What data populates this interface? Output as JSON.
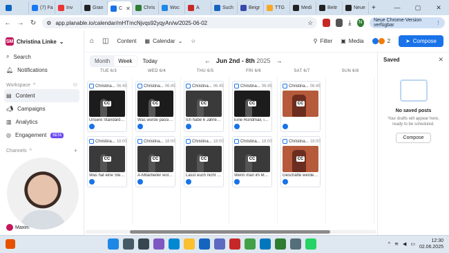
{
  "browser": {
    "tabs": [
      {
        "label": "",
        "color": "#0a66c2"
      },
      {
        "label": "(7) Fa",
        "color": "#1877f2"
      },
      {
        "label": "Inv",
        "color": "#e33"
      },
      {
        "label": "Gran",
        "color": "#222"
      },
      {
        "label": "C",
        "color": "#1a73e8",
        "active": true
      },
      {
        "label": "Chris",
        "color": "#2e7d32"
      },
      {
        "label": "Woc",
        "color": "#1e88e5"
      },
      {
        "label": "A",
        "color": "#c62828"
      },
      {
        "label": "Such",
        "color": "#1565c0"
      },
      {
        "label": "Beigr",
        "color": "#3949ab"
      },
      {
        "label": "TTG",
        "color": "#f9a825"
      },
      {
        "label": "Medi",
        "color": "#222"
      },
      {
        "label": "Beitr",
        "color": "#222"
      },
      {
        "label": "Neue",
        "color": "#222"
      }
    ],
    "url": "app.planable.io/calendar/mHTmcNjvqs92yqyAn/w/2025-06-02",
    "update_label": "Neue Chrome-Version verfügbar",
    "profile_initial": "N"
  },
  "sidebar": {
    "workspace_name": "Christina Linke",
    "logo_text": "SM",
    "items": [
      {
        "label": "Search",
        "icon": "search-icon"
      },
      {
        "label": "Notifications",
        "icon": "bell-icon"
      }
    ],
    "workspace_section": "Workspace",
    "workspace_items": [
      {
        "label": "Content",
        "icon": "content-icon",
        "active": true
      },
      {
        "label": "Campaigns",
        "icon": "megaphone-icon"
      },
      {
        "label": "Analytics",
        "icon": "analytics-icon"
      },
      {
        "label": "Engagement",
        "icon": "engagement-icon",
        "badge": "BETA"
      }
    ],
    "channels_section": "Channels",
    "user_label": "Maxim"
  },
  "topbar": {
    "content_label": "Content",
    "calendar_label": "Calendar",
    "filter_label": "Filter",
    "media_label": "Media",
    "avatars_count": "2",
    "compose_label": "Compose"
  },
  "calendar": {
    "view_month": "Month",
    "view_week": "Week",
    "today_label": "Today",
    "range": "Jun 2nd - 8th",
    "year": "2025",
    "days": [
      "TUE 6/3",
      "WED 6/4",
      "THU 6/5",
      "FRI 6/6",
      "SAT 6/7",
      "SUN 6/8"
    ],
    "columns": [
      {
        "posts": [
          {
            "author": "Christina...",
            "time": "06:45",
            "caption": "Unsere Standards g...",
            "style": "dark"
          },
          {
            "author": "Christina...",
            "time": "18:00",
            "caption": "Was hat eine Steuer...",
            "style": "stage"
          }
        ]
      },
      {
        "posts": [
          {
            "author": "Christina...",
            "time": "06:45",
            "caption": "Was würde passiere...",
            "style": "dark"
          },
          {
            "author": "Christina...",
            "time": "18:00",
            "caption": "A-Mitarbeiter wolle...",
            "style": "stage"
          }
        ]
      },
      {
        "posts": [
          {
            "author": "Christina...",
            "time": "06:45",
            "caption": "Ich habe 6 Jahre lan...",
            "style": "stage"
          },
          {
            "author": "Christina...",
            "time": "18:00",
            "caption": "Lasst euch nicht vo...",
            "style": "stage"
          }
        ]
      },
      {
        "posts": [
          {
            "author": "Christina...",
            "time": "06:45",
            "caption": "Eine Rundmail, in d...",
            "style": "dark"
          },
          {
            "author": "Christina...",
            "time": "18:00",
            "caption": "Wenn man im Mom...",
            "style": "stage"
          }
        ]
      },
      {
        "posts": [
          {
            "author": "Christina...",
            "time": "06:45",
            "caption": "",
            "style": "warm"
          },
          {
            "author": "Christina...",
            "time": "18:00",
            "caption": "Geschäfte werden z...",
            "style": "warm"
          }
        ]
      },
      {
        "posts": []
      }
    ]
  },
  "saved": {
    "title": "Saved",
    "empty_title": "No saved posts",
    "empty_sub": "Your drafts will appear here, ready to be scheduled.",
    "compose_label": "Compose"
  },
  "taskbar": {
    "time": "12:30",
    "date": "02.06.2025"
  },
  "colors": {
    "accent": "#1a73e8",
    "brand": "#c4175c",
    "beta": "#6d4df2"
  }
}
